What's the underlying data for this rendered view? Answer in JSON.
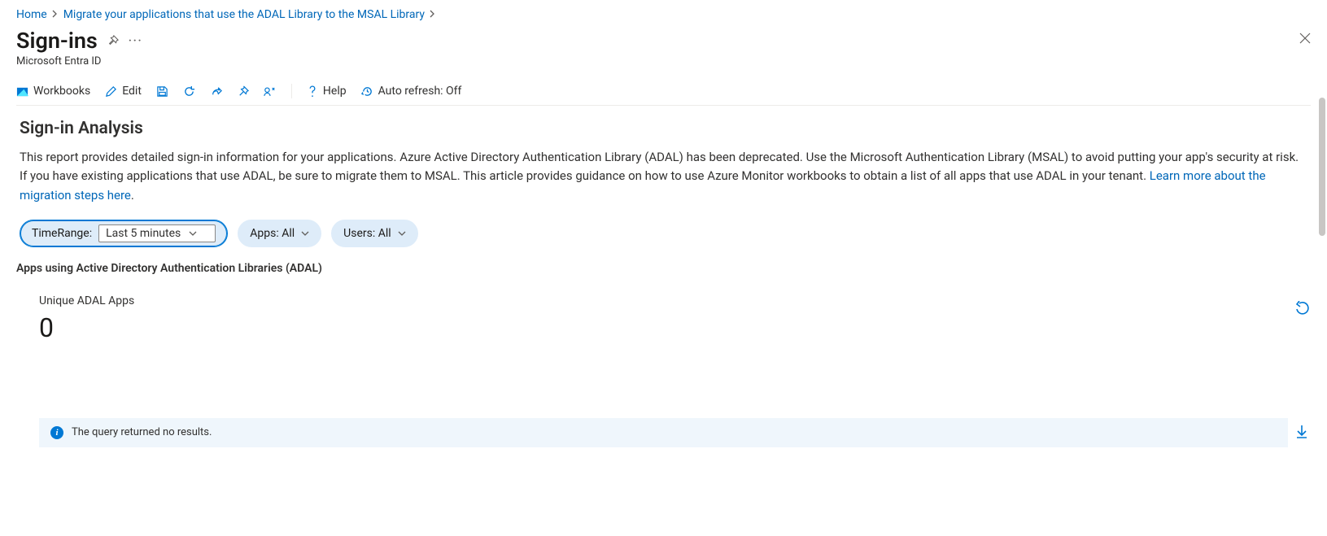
{
  "breadcrumb": {
    "items": [
      {
        "label": "Home"
      },
      {
        "label": "Migrate your applications that use the ADAL Library to the MSAL Library"
      }
    ]
  },
  "header": {
    "title": "Sign-ins",
    "subtitle": "Microsoft Entra ID"
  },
  "toolbar": {
    "workbooks": "Workbooks",
    "edit": "Edit",
    "help": "Help",
    "autorefresh": "Auto refresh: Off"
  },
  "analysis": {
    "heading": "Sign-in Analysis",
    "body": "This report provides detailed sign-in information for your applications. Azure Active Directory Authentication Library (ADAL) has been deprecated. Use the Microsoft Authentication Library (MSAL) to avoid putting your app's security at risk. If you have existing applications that use ADAL, be sure to migrate them to MSAL. This article provides guidance on how to use Azure Monitor workbooks to obtain a list of all apps that use ADAL in your tenant. ",
    "link_text": "Learn more about the migration steps here",
    "period": "."
  },
  "filters": {
    "timerange_label": "TimeRange:",
    "timerange_value": "Last 5 minutes",
    "apps": "Apps: All",
    "users": "Users: All"
  },
  "results": {
    "section_label": "Apps using Active Directory Authentication Libraries (ADAL)",
    "metric_label": "Unique ADAL Apps",
    "metric_value": "0",
    "banner": "The query returned no results."
  }
}
